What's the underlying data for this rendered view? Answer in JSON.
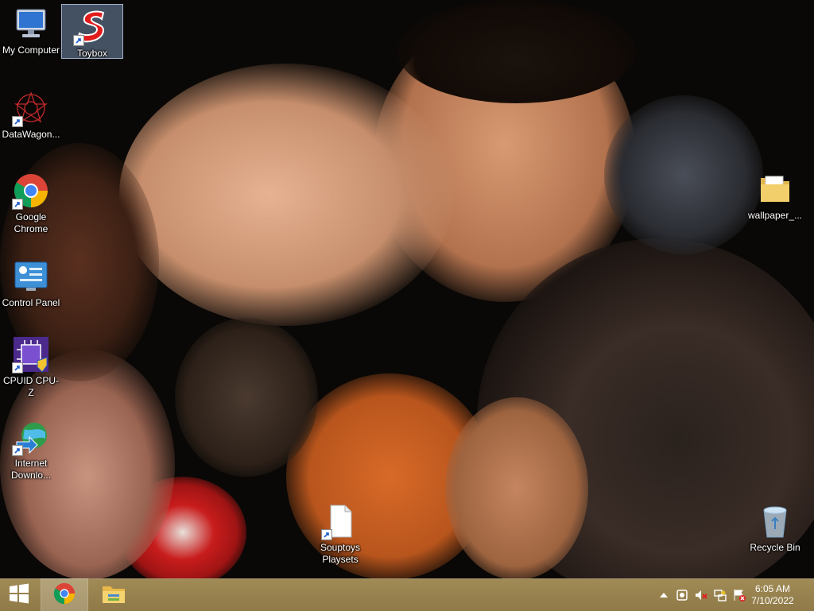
{
  "desktop": {
    "icons": [
      {
        "id": "my-computer",
        "label": "My Computer",
        "icon": "monitor-icon"
      },
      {
        "id": "toybox",
        "label": "Toybox",
        "icon": "toybox-s-icon",
        "selected": true
      },
      {
        "id": "datawagon",
        "label": "DataWagon...",
        "icon": "datawagon-icon"
      },
      {
        "id": "chrome",
        "label": "Google Chrome",
        "icon": "chrome-icon"
      },
      {
        "id": "control-panel",
        "label": "Control Panel",
        "icon": "control-panel-icon"
      },
      {
        "id": "cpuz",
        "label": "CPUID CPU-Z",
        "icon": "cpuz-icon"
      },
      {
        "id": "idm",
        "label": "Internet Downlo...",
        "icon": "globe-download-icon"
      },
      {
        "id": "souptoys",
        "label": "Souptoys Playsets",
        "icon": "document-icon"
      },
      {
        "id": "wallpaper",
        "label": "wallpaper_...",
        "icon": "folder-icon"
      },
      {
        "id": "recycle-bin",
        "label": "Recycle Bin",
        "icon": "recycle-bin-icon"
      }
    ]
  },
  "taskbar": {
    "start": "windows-logo-icon",
    "pinned": [
      "chrome-icon",
      "file-explorer-icon"
    ],
    "tray": [
      "chevron-up-icon",
      "network-adapter-icon",
      "volume-muted-icon",
      "network-icon",
      "action-center-icon"
    ]
  },
  "clock": {
    "time": "6:05 AM",
    "date": "7/10/2022"
  }
}
